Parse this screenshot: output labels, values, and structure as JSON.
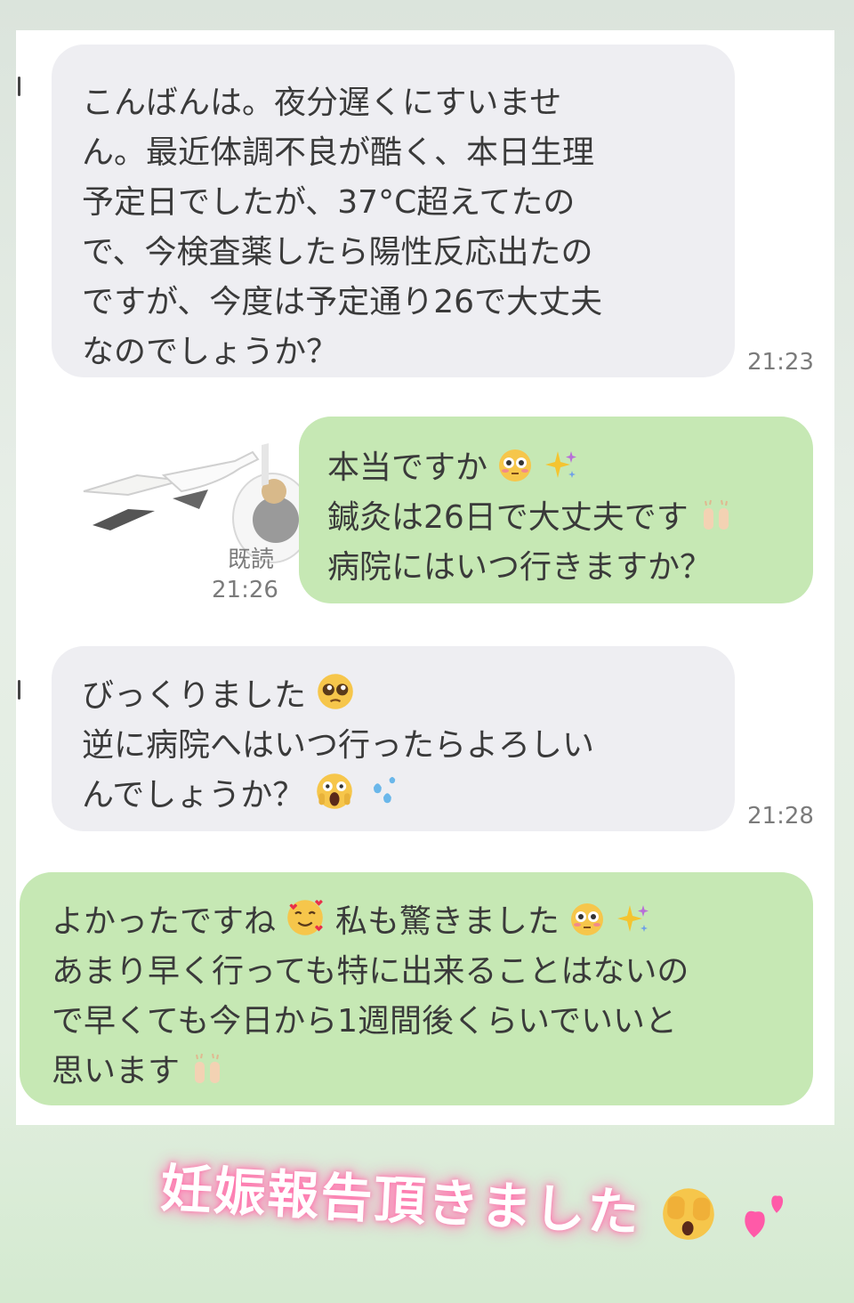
{
  "messages": [
    {
      "lines": [
        "こんばんは。夜分遅くにすいませ",
        "ん。最近体調不良が酷く、本日生理",
        "予定日でしたが、37°C超えてたの",
        "で、今検査薬したら陽性反応出たの",
        "ですが、今度は予定通り26で大丈夫",
        "なのでしょうか？"
      ],
      "time": "21:23"
    },
    {
      "line1": "本当ですか",
      "line2": "鍼灸は26日で大丈夫です",
      "line3": "病院にはいつ行きますか？",
      "read_label": "既読",
      "time": "21:26"
    },
    {
      "line1": "びっくりました",
      "line2": "逆に病院へはいつ行ったらよろしい",
      "line3": "んでしょうか？",
      "time": "21:28"
    },
    {
      "line1a": "よかったですね",
      "line1b": "私も驚きました",
      "line2": "あまり早く行っても特に出来ることはないの",
      "line3": "で早くても今日から1週間後くらいでいいと",
      "line4": "思います"
    }
  ],
  "caption": "妊娠報告頂きました",
  "colors": {
    "received_bubble": "#eeeef2",
    "sent_bubble": "#c6e8b4",
    "caption_glow": "#ff6fa8"
  },
  "icons": [
    "flushed-face-icon",
    "sparkles-icon",
    "raised-hands-icon",
    "pleading-face-icon",
    "scream-face-icon",
    "sweat-droplets-icon",
    "smiling-hearts-face-icon",
    "face-with-hands-over-eyes-icon",
    "two-hearts-icon",
    "stork-sticker"
  ]
}
